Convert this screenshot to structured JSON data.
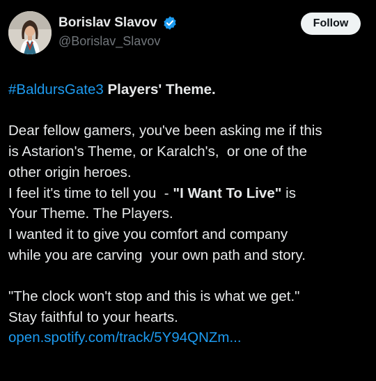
{
  "author": {
    "display_name": "Borislav Slavov",
    "handle": "@Borislav_Slavov"
  },
  "follow_label": "Follow",
  "post": {
    "hashtag": "#BaldursGate3",
    "title_rest": " Players' Theme.",
    "p1": [
      "Dear fellow gamers, you've been asking me if this",
      "is Astarion's Theme, or Karalch's,  or one of the",
      "other origin heroes."
    ],
    "l4_pre": "I feel it's time to tell you  - ",
    "l4_bold": "\"I Want To Live\"",
    "l4_post": " is",
    "p2": [
      "Your Theme. The Players.",
      "I wanted it to give you comfort and company",
      "while you are carving  your own path and story."
    ],
    "p3": [
      "\"The clock won't stop and this is what we get.\"",
      "Stay faithful to your hearts."
    ],
    "link": "open.spotify.com/track/5Y94QNZm..."
  },
  "colors": {
    "background": "#000000",
    "text": "#e7e9ea",
    "secondary": "#71767b",
    "link": "#1d9bf0",
    "verified": "#1d9bf0"
  }
}
